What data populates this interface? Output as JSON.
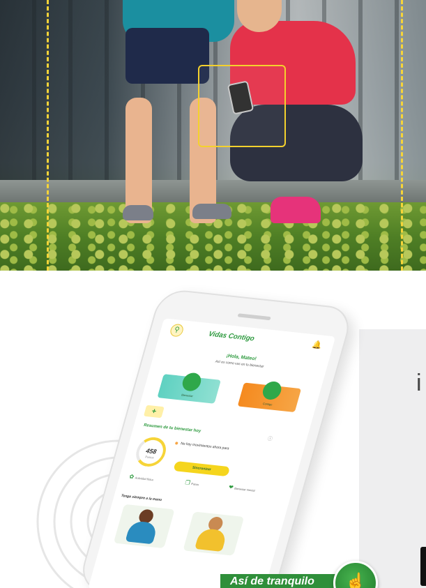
{
  "promo": {
    "slogan": "Así de tranquilo",
    "side_glyph": "i"
  },
  "app": {
    "title": "Vidas Contigo",
    "greeting": "¡Hola, Mateo!",
    "subgreeting": "Así es como vas en tu bienestar",
    "cards": [
      {
        "caption": "Bienestar"
      },
      {
        "caption": "Contigo"
      }
    ],
    "summary_title": "Resumen de tu bienestar hoy",
    "score_value": "458",
    "score_unit": "Puntos",
    "no_data_text": "No hay movimientos ahora para",
    "cta_label": "Sincronizar",
    "metrics": [
      {
        "icon": "leaf-icon",
        "label": "Actividad física"
      },
      {
        "icon": "steps-icon",
        "label": "Pasos"
      },
      {
        "icon": "heart-icon",
        "label": "Bienestar mental"
      }
    ],
    "section_title": "Tenga siempre a la mano"
  },
  "colors": {
    "brand_green": "#2e9a3f",
    "accent_yellow": "#f6d438",
    "orange": "#f58a1f",
    "teal": "#5fd1c1"
  }
}
